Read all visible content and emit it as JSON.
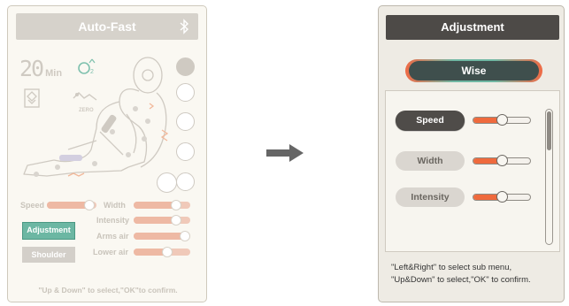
{
  "left": {
    "title": "Auto-Fast",
    "timer_value": "20",
    "timer_unit": "Min",
    "zero_label": "ZERO",
    "controls": {
      "speed": "Speed",
      "width": "Width",
      "intensity": "Intensity",
      "arms_air": "Arms air",
      "lower_air": "Lower air"
    },
    "adjustment_button": "Adjustment",
    "shoulder_button": "Shoulder",
    "hint": "\"Up & Down\" to select,\"OK\"to confirm.",
    "slider_levels": {
      "speed": 0.85,
      "width": 0.75,
      "intensity": 0.75,
      "arms_air": 0.9,
      "lower_air": 0.6
    }
  },
  "right": {
    "title": "Adjustment",
    "mode": "Wise",
    "items": [
      {
        "label": "Speed",
        "active": true,
        "level": 0.5
      },
      {
        "label": "Width",
        "active": false,
        "level": 0.5
      },
      {
        "label": "Intensity",
        "active": false,
        "level": 0.5
      }
    ],
    "hint_line1": "\"Left&Right\" to select sub menu,",
    "hint_line2": "\"Up&Down\" to select,\"OK\" to confirm."
  },
  "colors": {
    "accent_orange": "#ef6a3d",
    "accent_teal": "#6cb7a3",
    "dark": "#4d4a47",
    "faded": "#cfcac2"
  },
  "icons": [
    "bluetooth-icon",
    "oxygen-icon",
    "layers-icon",
    "zero-gravity-icon",
    "massage-chair-icon",
    "arrow-right-icon"
  ]
}
